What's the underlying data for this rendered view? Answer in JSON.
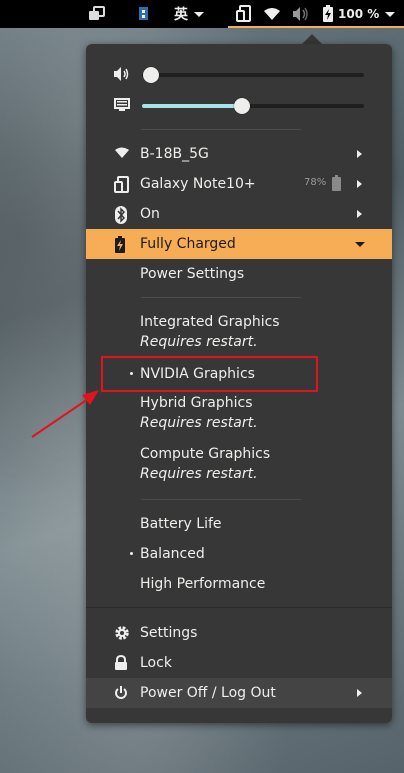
{
  "panel": {
    "ime_label": "英",
    "battery_percent": "100 %"
  },
  "sliders": {
    "volume_level": 0.04,
    "brightness_level": 0.45
  },
  "network": {
    "wifi_label": "B-18B_5G",
    "device_label": "Galaxy Note10+",
    "device_battery": "78%",
    "bluetooth_label": "On"
  },
  "power": {
    "status_label": "Fully Charged",
    "settings_label": "Power Settings"
  },
  "graphics": {
    "integrated_label": "Integrated Graphics",
    "integrated_note": "Requires restart.",
    "nvidia_label": "NVIDIA Graphics",
    "hybrid_label": "Hybrid Graphics",
    "hybrid_note": "Requires restart.",
    "compute_label": "Compute Graphics",
    "compute_note": "Requires restart."
  },
  "profiles": {
    "battery_life_label": "Battery Life",
    "balanced_label": "Balanced",
    "high_performance_label": "High Performance"
  },
  "system": {
    "settings_label": "Settings",
    "lock_label": "Lock",
    "power_off_label": "Power Off / Log Out"
  },
  "colors": {
    "accent": "#f6ad55",
    "slider_fill": "#a7e4e8",
    "menu_bg": "#373737",
    "annotation_red": "#e0141e"
  }
}
